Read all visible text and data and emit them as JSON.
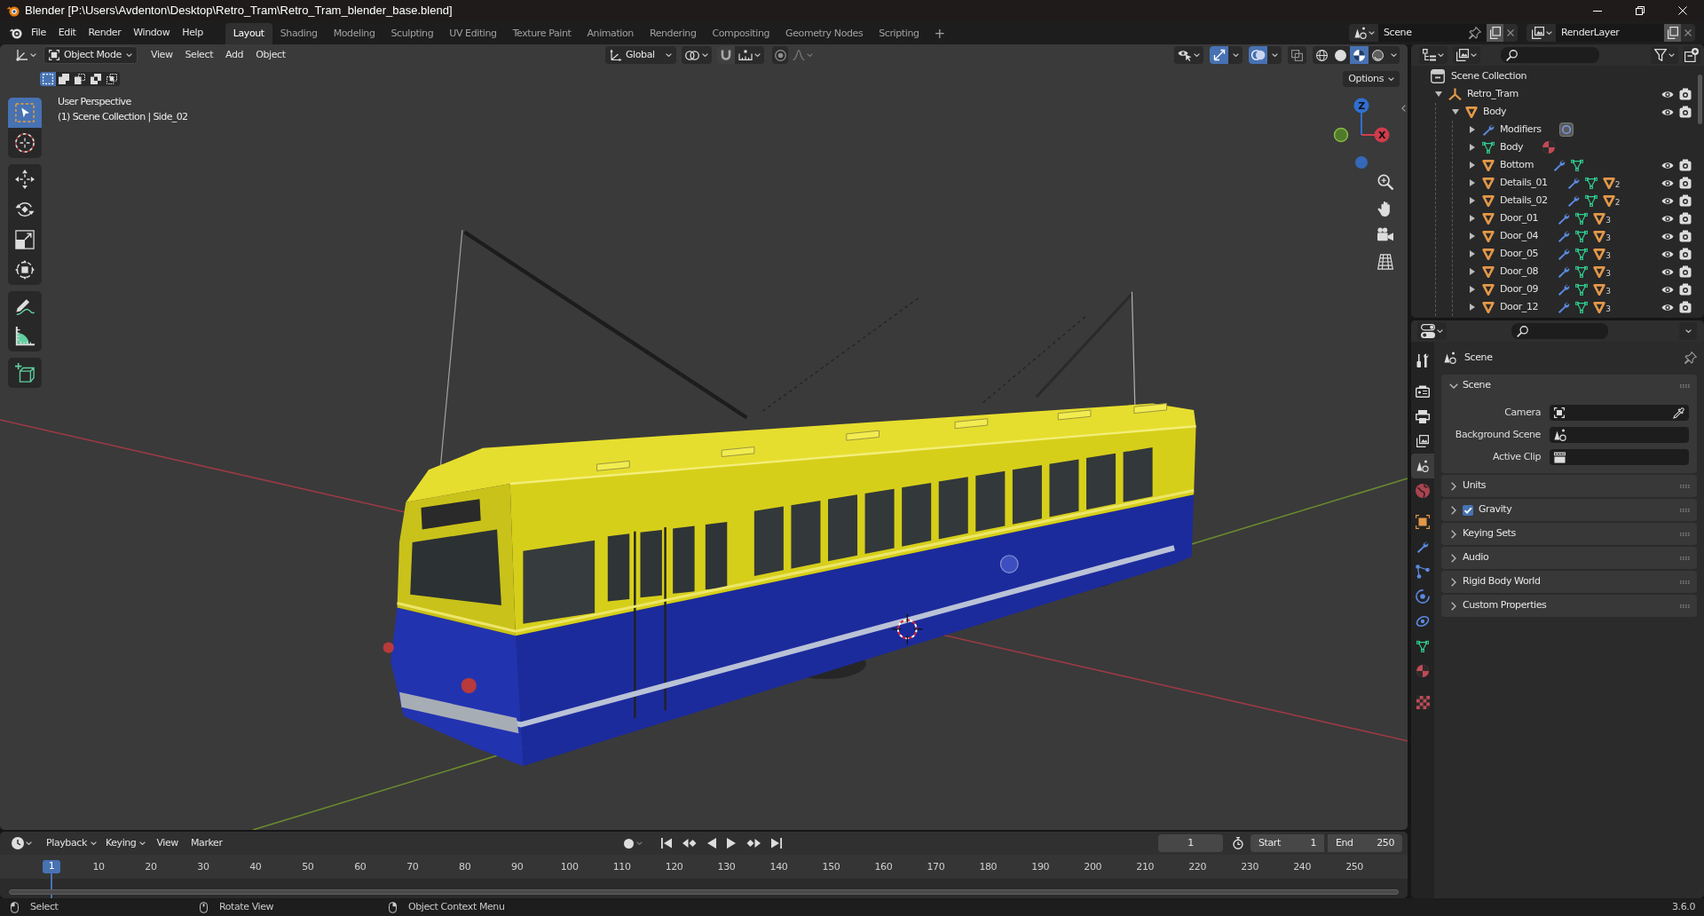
{
  "window": {
    "title": "Blender [P:\\Users\\Avdenton\\Desktop\\Retro_Tram\\Retro_Tram_blender_base.blend]"
  },
  "menu": [
    "File",
    "Edit",
    "Render",
    "Window",
    "Help"
  ],
  "workspace_tabs": [
    {
      "label": "Layout",
      "selected": true
    },
    {
      "label": "Shading",
      "selected": false
    },
    {
      "label": "Modeling",
      "selected": false
    },
    {
      "label": "Sculpting",
      "selected": false
    },
    {
      "label": "UV Editing",
      "selected": false
    },
    {
      "label": "Texture Paint",
      "selected": false
    },
    {
      "label": "Animation",
      "selected": false
    },
    {
      "label": "Rendering",
      "selected": false
    },
    {
      "label": "Compositing",
      "selected": false
    },
    {
      "label": "Geometry Nodes",
      "selected": false
    },
    {
      "label": "Scripting",
      "selected": false
    }
  ],
  "add_workspace": "+",
  "scene": "Scene",
  "view_layer": "RenderLayer",
  "viewport": {
    "mode": "Object Mode",
    "menus": [
      "View",
      "Select",
      "Add",
      "Object"
    ],
    "orientation": "Global",
    "select_modes": [
      {
        "kind": "set",
        "selected": true
      },
      {
        "kind": "extend",
        "selected": false
      },
      {
        "kind": "subtract",
        "selected": false
      },
      {
        "kind": "difference",
        "selected": false
      },
      {
        "kind": "intersect",
        "selected": false
      }
    ],
    "toggles": [
      {
        "kind": "gizmos",
        "on": true
      },
      {
        "kind": "overlays",
        "on": true
      },
      {
        "kind": "xray",
        "on": false
      }
    ],
    "shading": [
      {
        "kind": "wireframe",
        "selected": false
      },
      {
        "kind": "solid",
        "selected": false
      },
      {
        "kind": "material",
        "selected": true
      },
      {
        "kind": "rendered",
        "selected": false
      }
    ],
    "options": "Options",
    "view_name": "User Perspective",
    "context": "(1) Scene Collection | Side_02",
    "tools": [
      {
        "kind": "select_box",
        "selected": true
      },
      {
        "kind": "cursor",
        "selected": false
      },
      {
        "kind": "move",
        "selected": false
      },
      {
        "kind": "rotate",
        "selected": false
      },
      {
        "kind": "scale",
        "selected": false
      },
      {
        "kind": "transform",
        "selected": false
      },
      {
        "kind": "annotate",
        "selected": false
      },
      {
        "kind": "measure",
        "selected": false
      },
      {
        "kind": "add_cube",
        "selected": false
      }
    ],
    "gizmo_axes": [
      {
        "label": "Z",
        "color": "#2f6fd1"
      },
      {
        "label": "X",
        "color": "#d03c4c"
      }
    ]
  },
  "outliner": {
    "root": "Scene Collection",
    "items": [
      {
        "kind": "collection",
        "label": "Retro_Tram",
        "expanded": true,
        "visible": true,
        "renderable": true,
        "children": [
          {
            "kind": "object",
            "label": "Body",
            "expanded": true,
            "visible": true,
            "renderable": true,
            "children": [
              {
                "kind": "modifiers",
                "label": "Modifiers",
                "expanded": false
              },
              {
                "kind": "mesh",
                "label": "Body",
                "expanded": false
              },
              {
                "kind": "object",
                "label": "Bottom",
                "expanded": false,
                "visible": true,
                "renderable": true
              },
              {
                "kind": "object",
                "label": "Details_01",
                "expanded": false,
                "visible": true,
                "renderable": true,
                "child_count": "2"
              },
              {
                "kind": "object",
                "label": "Details_02",
                "expanded": false,
                "visible": true,
                "renderable": true,
                "child_count": "2"
              },
              {
                "kind": "object",
                "label": "Door_01",
                "expanded": false,
                "visible": true,
                "renderable": true,
                "child_count": "3"
              },
              {
                "kind": "object",
                "label": "Door_04",
                "expanded": false,
                "visible": true,
                "renderable": true,
                "child_count": "3"
              },
              {
                "kind": "object",
                "label": "Door_05",
                "expanded": false,
                "visible": true,
                "renderable": true,
                "child_count": "3"
              },
              {
                "kind": "object",
                "label": "Door_08",
                "expanded": false,
                "visible": true,
                "renderable": true,
                "child_count": "3"
              },
              {
                "kind": "object",
                "label": "Door_09",
                "expanded": false,
                "visible": true,
                "renderable": true,
                "child_count": "3"
              },
              {
                "kind": "object",
                "label": "Door_12",
                "expanded": false,
                "visible": true,
                "renderable": true,
                "child_count": "3"
              }
            ]
          }
        ]
      }
    ]
  },
  "properties": {
    "tabs": [
      {
        "kind": "tool",
        "selected": false
      },
      {
        "kind": "render",
        "selected": false
      },
      {
        "kind": "output",
        "selected": false
      },
      {
        "kind": "view_layer",
        "selected": false
      },
      {
        "kind": "scene",
        "selected": true
      },
      {
        "kind": "world",
        "selected": false
      },
      {
        "kind": "object",
        "selected": false
      },
      {
        "kind": "modifiers",
        "selected": false
      },
      {
        "kind": "particles",
        "selected": false
      },
      {
        "kind": "physics",
        "selected": false
      },
      {
        "kind": "constraints",
        "selected": false
      },
      {
        "kind": "data",
        "selected": false
      },
      {
        "kind": "material",
        "selected": false
      },
      {
        "kind": "texture",
        "selected": false
      }
    ],
    "context": "Scene",
    "panels": [
      {
        "kind": "section",
        "title": "Scene",
        "expanded": true,
        "fields": [
          {
            "kind": "camera",
            "label": "Camera"
          },
          {
            "kind": "scene",
            "label": "Background Scene"
          },
          {
            "kind": "clip",
            "label": "Active Clip"
          }
        ]
      },
      {
        "kind": "section",
        "title": "Units",
        "expanded": false
      },
      {
        "kind": "toggle_section",
        "title": "Gravity",
        "expanded": false,
        "checked": true
      },
      {
        "kind": "section",
        "title": "Keying Sets",
        "expanded": false
      },
      {
        "kind": "section",
        "title": "Audio",
        "expanded": false
      },
      {
        "kind": "section",
        "title": "Rigid Body World",
        "expanded": false
      },
      {
        "kind": "section",
        "title": "Custom Properties",
        "expanded": false
      }
    ]
  },
  "timeline": {
    "menus": [
      {
        "kind": "dropdown",
        "label": "Playback"
      },
      {
        "kind": "dropdown",
        "label": "Keying"
      },
      {
        "kind": "menu",
        "label": "View"
      },
      {
        "kind": "menu",
        "label": "Marker"
      }
    ],
    "current_frame": "1",
    "start_label": "Start",
    "start": "1",
    "end_label": "End",
    "end": "250",
    "playhead": "1",
    "ruler": [
      "10",
      "20",
      "30",
      "40",
      "50",
      "60",
      "70",
      "80",
      "90",
      "100",
      "110",
      "120",
      "130",
      "140",
      "150",
      "160",
      "170",
      "180",
      "190",
      "200",
      "210",
      "220",
      "230",
      "240",
      "250"
    ]
  },
  "status_bar": {
    "hints": [
      {
        "kind": "left_click",
        "label": "Select"
      },
      {
        "kind": "middle_click",
        "label": "Rotate View"
      },
      {
        "kind": "right_click",
        "label": "Object Context Menu"
      }
    ],
    "version": "3.6.0"
  }
}
